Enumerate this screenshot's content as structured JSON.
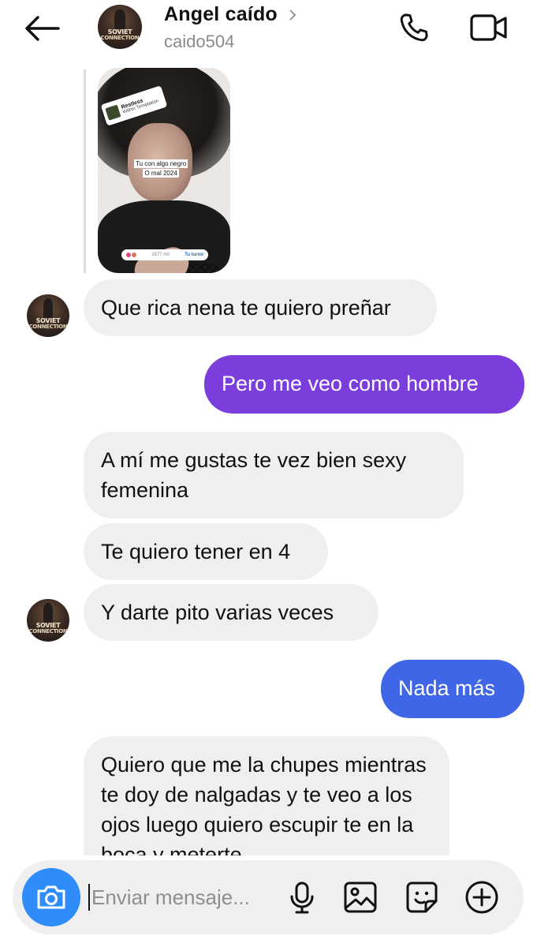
{
  "header": {
    "name": "Angel caído",
    "username": "caido504",
    "avatar_text_1": "SOVIET",
    "avatar_text_2": "CONNECTION"
  },
  "story": {
    "song_title": "Restless",
    "song_artist": "Within Temptation",
    "caption_line_1": "Tu con algo negro",
    "caption_line_2": "O mal 2024",
    "viewers_count": "1677 mil",
    "reply_label": "Tu turno"
  },
  "messages": [
    {
      "from": "them",
      "text": "Que rica nena te quiero preñar"
    },
    {
      "from": "me",
      "text": "Pero me veo como hombre"
    },
    {
      "from": "them",
      "text": "A mí me gustas te vez bien sexy femenina"
    },
    {
      "from": "them",
      "text": "Te quiero tener en 4"
    },
    {
      "from": "them",
      "text": "Y darte pito varias veces"
    },
    {
      "from": "me",
      "text": "Nada más"
    },
    {
      "from": "them",
      "text": "Quiero que me la chupes mientras te doy de nalgadas y te veo a los ojos luego quiero escupir te en la boca y meterte"
    }
  ],
  "composer": {
    "placeholder": "Enviar mensaje..."
  },
  "colors": {
    "outgoing_purple": "#7c3ddd",
    "outgoing_blue": "#3f66e6",
    "incoming_bg": "#efefef",
    "camera_button": "#2f8dfb"
  },
  "icons": [
    "back-arrow-icon",
    "chevron-right-icon",
    "phone-icon",
    "video-camera-icon",
    "camera-icon",
    "microphone-icon",
    "image-icon",
    "sticker-icon",
    "plus-circle-icon"
  ]
}
